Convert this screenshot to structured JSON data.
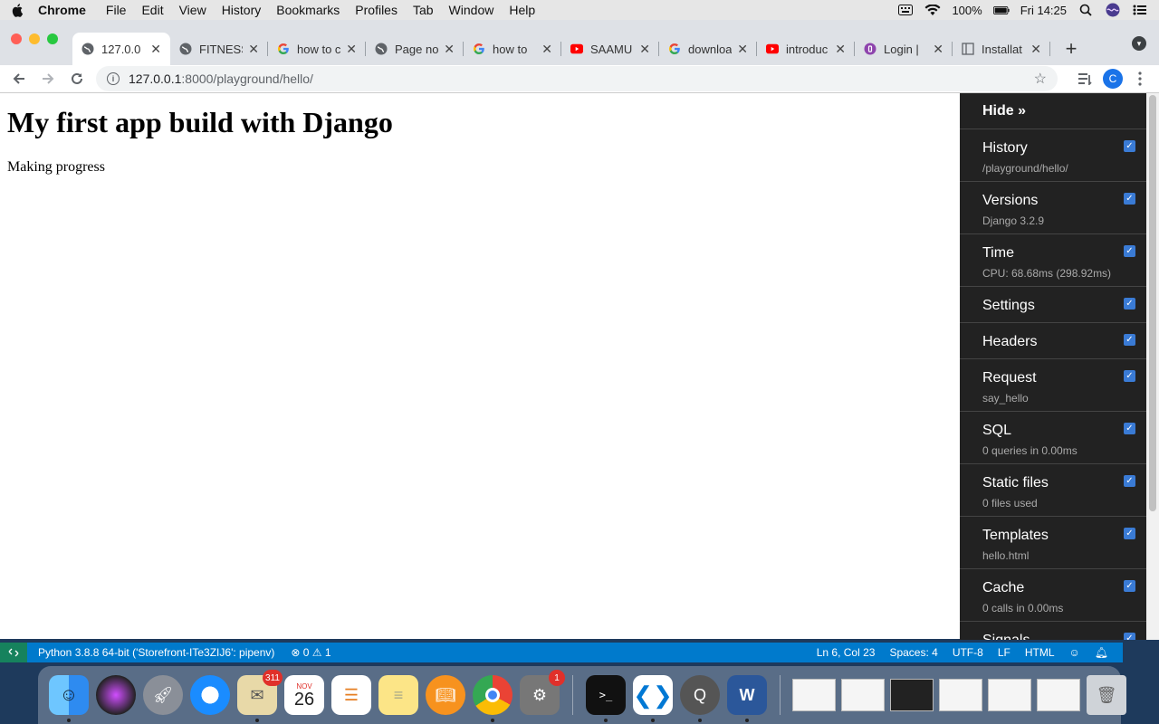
{
  "menubar": {
    "app_name": "Chrome",
    "items": [
      "File",
      "Edit",
      "View",
      "History",
      "Bookmarks",
      "Profiles",
      "Tab",
      "Window",
      "Help"
    ],
    "battery": "100%",
    "clock": "Fri 14:25"
  },
  "tabs": [
    {
      "title": "127.0.0",
      "icon": "globe-icon",
      "active": true
    },
    {
      "title": "FITNESS",
      "icon": "globe-icon",
      "active": false
    },
    {
      "title": "how to c",
      "icon": "google-icon",
      "active": false
    },
    {
      "title": "Page no",
      "icon": "globe-icon",
      "active": false
    },
    {
      "title": "how to",
      "icon": "google-icon",
      "active": false
    },
    {
      "title": "SAAMU",
      "icon": "youtube-icon",
      "active": false
    },
    {
      "title": "downloa",
      "icon": "google-icon",
      "active": false
    },
    {
      "title": "introduc",
      "icon": "youtube-icon",
      "active": false
    },
    {
      "title": "Login |",
      "icon": "login-site-icon",
      "active": false
    },
    {
      "title": "Installat",
      "icon": "docs-icon",
      "active": false
    }
  ],
  "address": {
    "host": "127.0.0.1",
    "path": ":8000/playground/hello/"
  },
  "profile_initial": "C",
  "page": {
    "heading": "My first app build with Django",
    "paragraph": "Making progress"
  },
  "debug_toolbar": {
    "hide_label": "Hide »",
    "panels": [
      {
        "title": "History",
        "subtitle": "/playground/hello/"
      },
      {
        "title": "Versions",
        "subtitle": "Django 3.2.9"
      },
      {
        "title": "Time",
        "subtitle": "CPU: 68.68ms (298.92ms)"
      },
      {
        "title": "Settings",
        "subtitle": ""
      },
      {
        "title": "Headers",
        "subtitle": ""
      },
      {
        "title": "Request",
        "subtitle": "say_hello"
      },
      {
        "title": "SQL",
        "subtitle": "0 queries in 0.00ms"
      },
      {
        "title": "Static files",
        "subtitle": "0 files used"
      },
      {
        "title": "Templates",
        "subtitle": "hello.html"
      },
      {
        "title": "Cache",
        "subtitle": "0 calls in 0.00ms"
      },
      {
        "title": "Signals",
        "subtitle": ""
      }
    ]
  },
  "statusbar": {
    "interpreter": "Python 3.8.8 64-bit ('Storefront-ITe3ZIJ6': pipenv)",
    "problems": "⊗ 0 ⚠ 1",
    "position": "Ln 6, Col 23",
    "spaces": "Spaces: 4",
    "encoding": "UTF-8",
    "eol": "LF",
    "language": "HTML"
  },
  "dock": {
    "mail_badge": "311",
    "calendar_month": "NOV",
    "calendar_day": "26",
    "prefs_badge": "1"
  },
  "colors": {
    "statusbar": "#007acc",
    "debug_bg": "#222222",
    "checkbox": "#3a7bd5"
  }
}
